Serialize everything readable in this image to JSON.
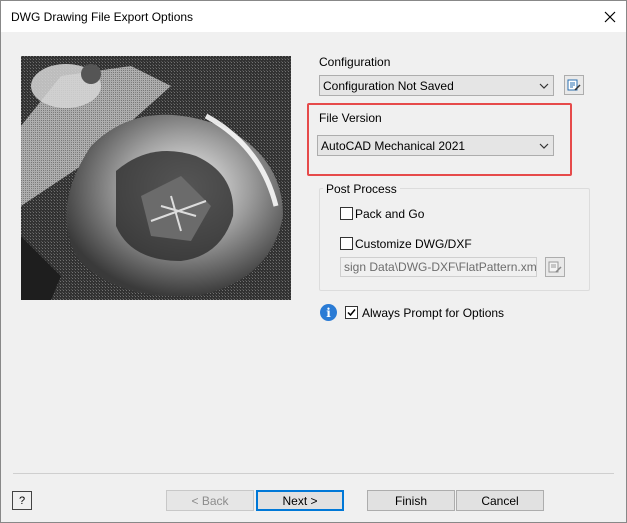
{
  "window": {
    "title": "DWG Drawing File Export Options"
  },
  "configuration": {
    "label": "Configuration",
    "value": "Configuration Not Saved"
  },
  "file_version": {
    "label": "File Version",
    "value": "AutoCAD Mechanical 2021"
  },
  "post_process": {
    "title": "Post Process",
    "pack_and_go": {
      "label": "Pack and Go",
      "checked": false
    },
    "customize": {
      "label": "Customize DWG/DXF",
      "checked": false
    },
    "path_value": "sign Data\\DWG-DXF\\FlatPattern.xml"
  },
  "always_prompt": {
    "label": "Always Prompt for Options",
    "checked": true
  },
  "buttons": {
    "back": "< Back",
    "next": "Next >",
    "finish": "Finish",
    "cancel": "Cancel",
    "help": "?"
  },
  "colors": {
    "highlight": "#e64a4a",
    "info": "#2a7bd5",
    "default_button_border": "#0078d7"
  }
}
